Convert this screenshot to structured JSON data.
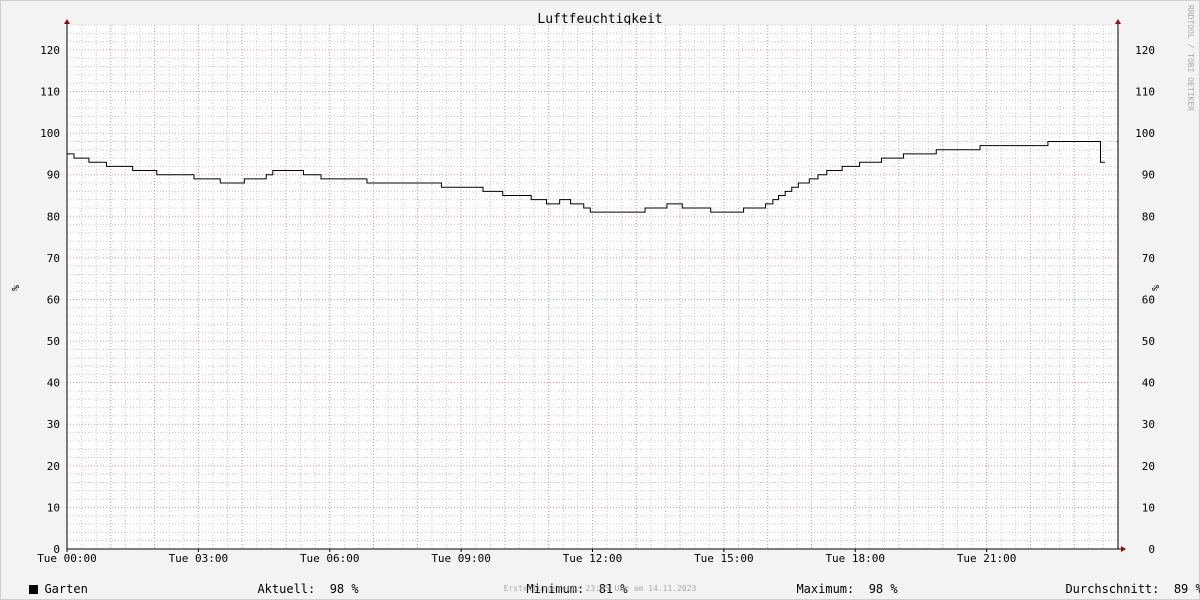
{
  "chart_data": {
    "type": "line",
    "title": "Luftfeuchtigkeit",
    "ylabel": "%",
    "ylim": [
      0,
      126
    ],
    "yticks": [
      0,
      10,
      20,
      30,
      40,
      50,
      60,
      70,
      80,
      90,
      100,
      110,
      120
    ],
    "xlim": [
      0,
      24
    ],
    "x_tick_hours": [
      0,
      3,
      6,
      9,
      12,
      15,
      18,
      21
    ],
    "x_tick_labels": [
      "Tue 00:00",
      "Tue 03:00",
      "Tue 06:00",
      "Tue 09:00",
      "Tue 12:00",
      "Tue 15:00",
      "Tue 18:00",
      "Tue 21:00"
    ],
    "x_unit": "hours of day (Tue)",
    "grid": true,
    "watermark": "RRDTOOL / TOBI OETIKER",
    "series": [
      {
        "name": "Garten",
        "color": "#000000",
        "step": true,
        "points": [
          [
            0.0,
            95
          ],
          [
            0.16,
            94
          ],
          [
            0.5,
            93
          ],
          [
            0.9,
            92
          ],
          [
            1.5,
            91
          ],
          [
            2.05,
            90
          ],
          [
            2.9,
            89
          ],
          [
            3.5,
            88
          ],
          [
            4.05,
            89
          ],
          [
            4.55,
            90
          ],
          [
            4.7,
            91
          ],
          [
            5.4,
            90
          ],
          [
            5.8,
            89
          ],
          [
            6.85,
            88
          ],
          [
            8.55,
            87
          ],
          [
            9.5,
            86
          ],
          [
            9.95,
            85
          ],
          [
            10.6,
            84
          ],
          [
            10.95,
            83
          ],
          [
            11.25,
            84
          ],
          [
            11.5,
            83
          ],
          [
            11.8,
            82
          ],
          [
            11.95,
            81
          ],
          [
            13.2,
            82
          ],
          [
            13.7,
            83
          ],
          [
            14.05,
            82
          ],
          [
            14.7,
            81
          ],
          [
            15.45,
            82
          ],
          [
            15.95,
            83
          ],
          [
            16.12,
            84
          ],
          [
            16.25,
            85
          ],
          [
            16.4,
            86
          ],
          [
            16.55,
            87
          ],
          [
            16.7,
            88
          ],
          [
            16.95,
            89
          ],
          [
            17.15,
            90
          ],
          [
            17.35,
            91
          ],
          [
            17.7,
            92
          ],
          [
            18.1,
            93
          ],
          [
            18.6,
            94
          ],
          [
            19.1,
            95
          ],
          [
            19.85,
            96
          ],
          [
            20.85,
            97
          ],
          [
            22.4,
            98
          ],
          [
            23.6,
            93
          ],
          [
            23.7,
            93
          ]
        ]
      }
    ],
    "legend": {
      "name": "Garten",
      "current_label": "Aktuell:",
      "current_value": "98 %",
      "min_label": "Minimum:",
      "min_value": "81 %",
      "max_label": "Maximum:",
      "max_value": "98 %",
      "avg_label": "Durchschnitt:",
      "avg_value": "89 %"
    },
    "footer": "Erstellungszeit: 23:55 Uhr am 14.11.2023"
  },
  "colors": {
    "background": "#f3f3f3",
    "plot_background": "#ffffff",
    "major_grid": "#ee9999",
    "minor_grid": "#cccccc",
    "axis": "#000000",
    "arrow": "#aa0000",
    "watermark": "#aaaaaa"
  }
}
